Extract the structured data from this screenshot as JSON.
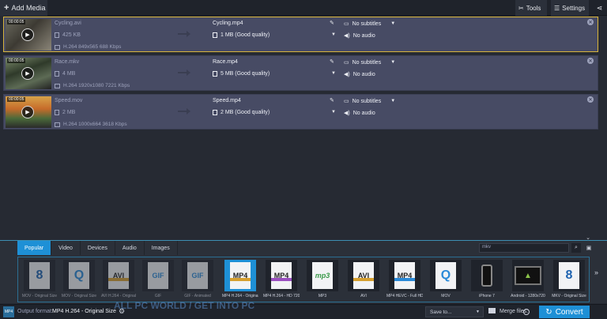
{
  "toolbar": {
    "add_media": "Add Media",
    "tools": "Tools",
    "settings": "Settings"
  },
  "files": [
    {
      "duration": "00:00:05",
      "source_name": "Cycling.avi",
      "source_size": "425 KB",
      "source_meta": "H.264 849x565 688 Kbps",
      "output_name": "Cycling.mp4",
      "output_size": "1 MB (Good quality)",
      "subtitles": "No subtitles",
      "audio": "No audio"
    },
    {
      "duration": "00:00:05",
      "source_name": "Race.mkv",
      "source_size": "4 MB",
      "source_meta": "H.264 1920x1080 7221 Kbps",
      "output_name": "Race.mp4",
      "output_size": "5 MB (Good quality)",
      "subtitles": "No subtitles",
      "audio": "No audio"
    },
    {
      "duration": "00:00:05",
      "source_name": "Speed.mov",
      "source_size": "2 MB",
      "source_meta": "H.264 1000x664 3618 Kbps",
      "output_name": "Speed.mp4",
      "output_size": "2 MB (Good quality)",
      "subtitles": "No subtitles",
      "audio": "No audio"
    }
  ],
  "panel": {
    "tabs": [
      "Popular",
      "Video",
      "Devices",
      "Audio",
      "Images"
    ],
    "search_value": "mkv",
    "formats": [
      {
        "badge": "",
        "label": "MOV - Original Size"
      },
      {
        "badge": "",
        "label": "MOV - Original Size"
      },
      {
        "badge": "AVI",
        "label": "AVI H.264 - Original"
      },
      {
        "badge": "GIF",
        "label": "GIF"
      },
      {
        "badge": "GIF",
        "label": "GIF - Animated"
      },
      {
        "badge": "MP4",
        "label": "MP4 H.264 - Original ..."
      },
      {
        "badge": "MP4",
        "label": "MP4 H.264 - HD 720p"
      },
      {
        "badge": "mp3",
        "label": "MP3"
      },
      {
        "badge": "AVI",
        "label": "AVI"
      },
      {
        "badge": "MP4",
        "label": "MP4 HEVC - Full HD 1..."
      },
      {
        "badge": "Q",
        "label": "MOV"
      },
      {
        "badge": "",
        "label": "iPhone 7"
      },
      {
        "badge": "",
        "label": "Android - 1280x720"
      },
      {
        "badge": "",
        "label": "MKV - Original Size"
      }
    ]
  },
  "bottom": {
    "output_format_label": "Output format:",
    "output_format_value": "MP4 H.264 - Original Size",
    "save_to": "Save to...",
    "merge_files": "Merge files:",
    "convert": "Convert"
  },
  "watermark": "ALL PC WORLD / GET INTO PC"
}
